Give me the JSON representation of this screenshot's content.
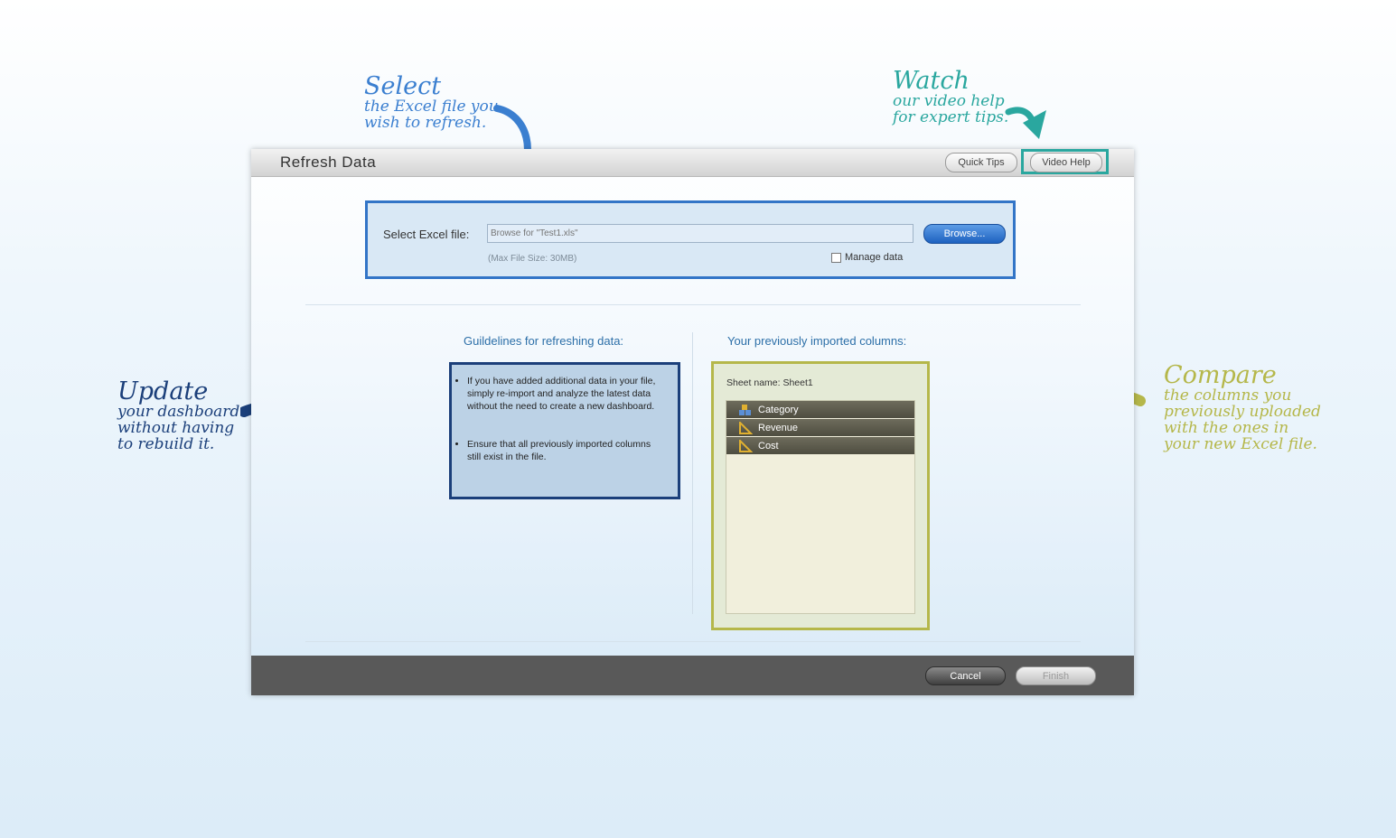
{
  "annotations": {
    "select": {
      "heading": "Select",
      "body_line1": "the Excel file you",
      "body_line2": "wish to refresh.",
      "color": "#3b7fd0"
    },
    "watch": {
      "heading": "Watch",
      "body_line1": "our video help",
      "body_line2": "for expert tips.",
      "color": "#2aa79f"
    },
    "update": {
      "heading": "Update",
      "body_line1": "your dashboard",
      "body_line2": "without having",
      "body_line3": "to rebuild it.",
      "color": "#1b3f7a"
    },
    "compare": {
      "heading": "Compare",
      "body_line1": "the columns you",
      "body_line2": "previously uploaded",
      "body_line3": "with the ones in",
      "body_line4": "your new Excel file.",
      "color": "#b5b74a"
    }
  },
  "dialog": {
    "title": "Refresh Data",
    "quick_tips_label": "Quick Tips",
    "video_help_label": "Video Help"
  },
  "file_select": {
    "label": "Select Excel file:",
    "placeholder": "Browse for \"Test1.xls\"",
    "browse_label": "Browse...",
    "max_size_text": "(Max File Size: 30MB)",
    "manage_data_label": "Manage data",
    "manage_data_checked": false
  },
  "guidelines": {
    "title": "Guildelines for refreshing data:",
    "items": [
      "If you have added additional data in your file, simply re-import and analyze the latest data without the need to create a new dashboard.",
      "Ensure that all previously imported columns still exist in the file."
    ]
  },
  "columns_panel": {
    "title": "Your previously imported columns:",
    "sheet_name": "Sheet name: Sheet1",
    "columns": [
      {
        "name": "Category",
        "icon": "dimension-icon"
      },
      {
        "name": "Revenue",
        "icon": "measure-icon"
      },
      {
        "name": "Cost",
        "icon": "measure-icon"
      }
    ]
  },
  "footer": {
    "cancel_label": "Cancel",
    "finish_label": "Finish"
  }
}
